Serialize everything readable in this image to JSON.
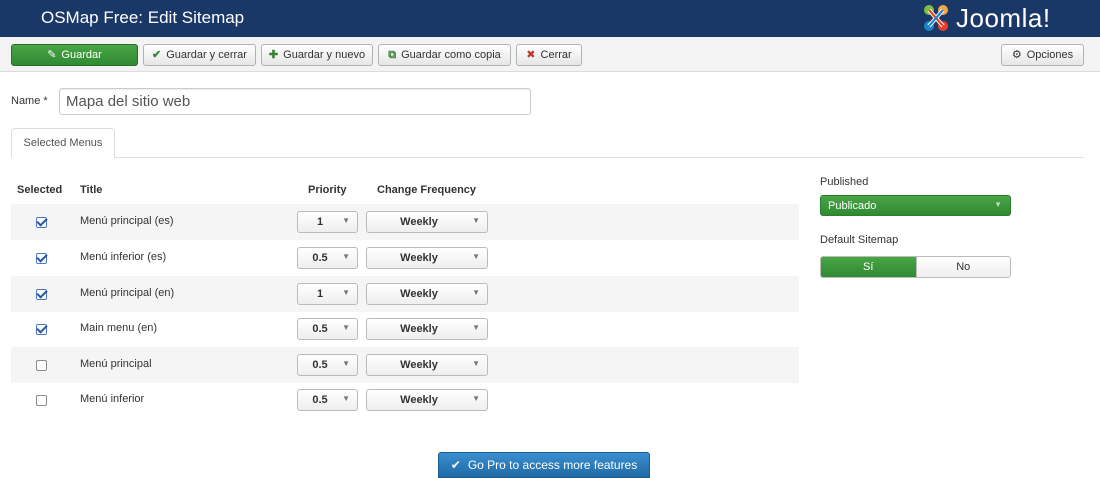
{
  "header": {
    "title": "OSMap Free: Edit Sitemap",
    "brand": "Joomla!",
    "brand_colors": [
      "#e7412a",
      "#f9a541",
      "#7ac143",
      "#1c84c6"
    ]
  },
  "toolbar": {
    "save_label": "Guardar",
    "save_close_label": "Guardar y cerrar",
    "save_new_label": "Guardar y nuevo",
    "save_copy_label": "Guardar como copia",
    "close_label": "Cerrar",
    "options_label": "Opciones",
    "icons": {
      "save": "edit-icon",
      "save_close": "check-icon",
      "save_new": "plus-icon",
      "save_copy": "copy-icon",
      "close": "cancel-circle-icon",
      "options": "gear-icon"
    }
  },
  "form": {
    "name_label": "Name *",
    "name_value": "Mapa del sitio web"
  },
  "tabs": [
    {
      "label": "Selected Menus",
      "active": true
    }
  ],
  "menus_table": {
    "headers": {
      "selected": "Selected",
      "title": "Title",
      "priority": "Priority",
      "change_frequency": "Change Frequency"
    },
    "rows": [
      {
        "selected": true,
        "title": "Menú principal (es)",
        "priority": "1",
        "frequency": "Weekly"
      },
      {
        "selected": true,
        "title": "Menú inferior (es)",
        "priority": "0.5",
        "frequency": "Weekly"
      },
      {
        "selected": true,
        "title": "Menú principal (en)",
        "priority": "1",
        "frequency": "Weekly"
      },
      {
        "selected": true,
        "title": "Main menu (en)",
        "priority": "0.5",
        "frequency": "Weekly"
      },
      {
        "selected": false,
        "title": "Menú principal",
        "priority": "0.5",
        "frequency": "Weekly"
      },
      {
        "selected": false,
        "title": "Menú inferior",
        "priority": "0.5",
        "frequency": "Weekly"
      }
    ]
  },
  "sidebar": {
    "published_label": "Published",
    "published_value": "Publicado",
    "default_label": "Default Sitemap",
    "default_yes": "Sí",
    "default_no": "No",
    "default_selected": "yes"
  },
  "promo": {
    "label": "Go Pro to access more features"
  },
  "colors": {
    "header_bg": "#1a3867",
    "primary_green": "#378137",
    "promo_blue": "#1f6aa5"
  }
}
